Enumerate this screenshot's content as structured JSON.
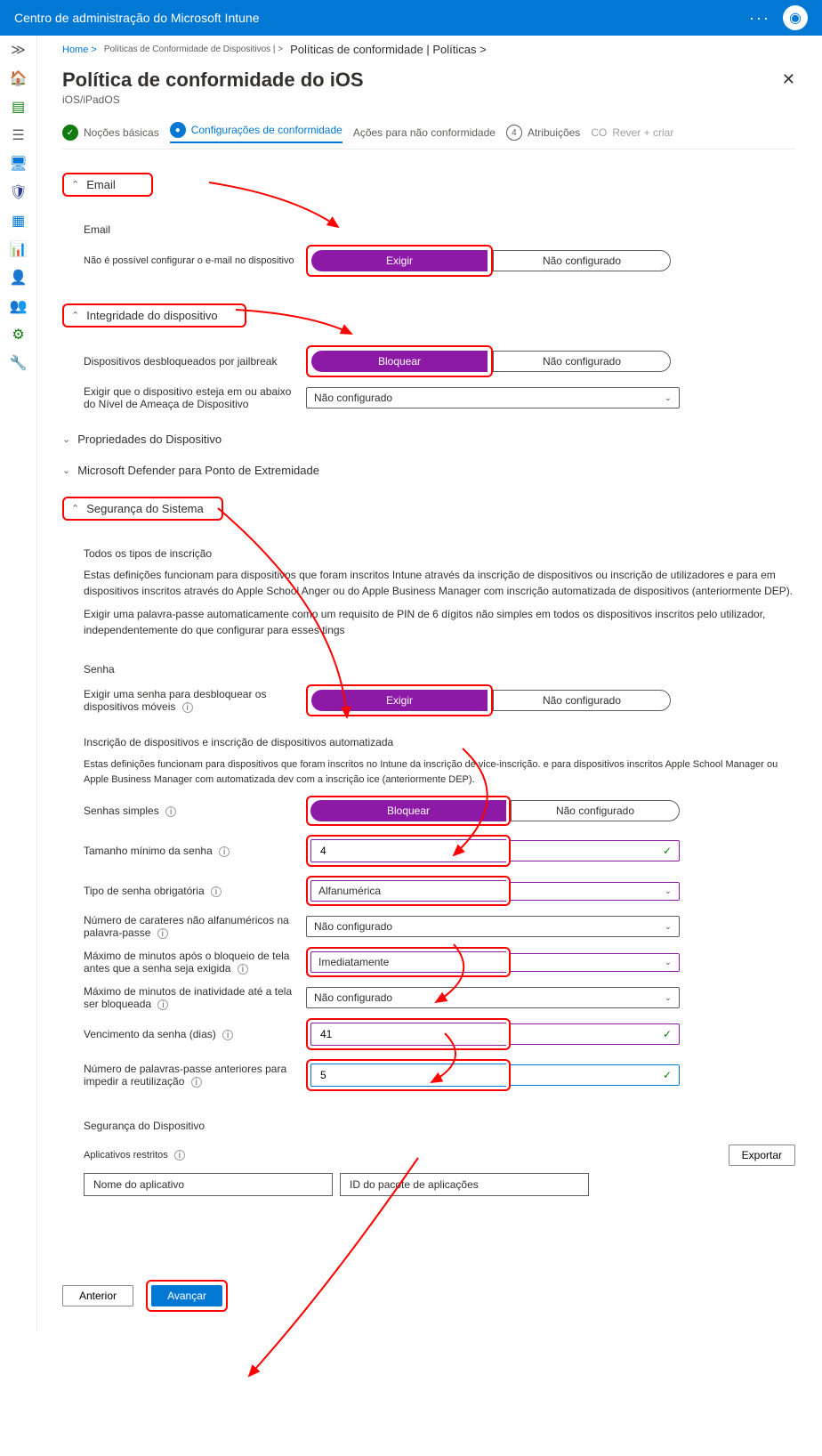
{
  "topbar": {
    "title": "Centro de administração do Microsoft Intune"
  },
  "breadcrumb": {
    "home": "Home >",
    "policies": "Políticas de Conformidade de Dispositivos | >",
    "current": "Políticas de conformidade | Políticas >"
  },
  "page": {
    "title": "Política de conformidade do iOS",
    "subtitle": "iOS/iPadOS"
  },
  "steps": {
    "s1": "Noções básicas",
    "s2": "Configurações de conformidade",
    "s3": "Ações para não conformidade",
    "s4num": "4",
    "s4": "Atribuições",
    "s5prefix": "CO",
    "s5": "Rever + criar"
  },
  "sections": {
    "email": "Email",
    "device_health": "Integridade do dispositivo",
    "device_props": "Propriedades do Dispositivo",
    "defender": "Microsoft Defender para Ponto de Extremidade",
    "system_security": "Segurança do Sistema"
  },
  "email": {
    "heading": "Email",
    "label": "Não é possível configurar o e-mail no dispositivo",
    "require": "Exigir",
    "not_configured": "Não configurado"
  },
  "device_health": {
    "jailbreak_label": "Dispositivos desbloqueados por jailbreak",
    "block": "Bloquear",
    "not_configured": "Não configurado",
    "threat_label": "Exigir que o dispositivo esteja em ou abaixo do Nível de Ameaça de Dispositivo",
    "threat_value": "Não configurado"
  },
  "system_security": {
    "all_enroll": "Todos os tipos de inscrição",
    "desc1": "Estas definições funcionam para dispositivos que foram inscritos   Intune através da inscrição de dispositivos ou inscrição de utilizadores e para em dispositivos inscritos através do Apple School Anger ou do Apple Business Manager com inscrição automatizada de dispositivos (anteriormente DEP).",
    "desc2": "Exigir uma palavra-passe automaticamente como um requisito de PIN de 6 dígitos não simples em todos os dispositivos inscritos pelo utilizador, independentemente do que configurar para esses tings",
    "password_heading": "Senha",
    "require_pwd_label": "Exigir uma senha para desbloquear os dispositivos móveis",
    "require": "Exigir",
    "not_configured": "Não configurado",
    "auto_enroll_heading": "Inscrição de dispositivos e inscrição de dispositivos automatizada",
    "auto_enroll_desc": "Estas definições funcionam para dispositivos que foram inscritos no    Intune           da inscrição de vice-inscrição. e para dispositivos inscritos Apple School Manager ou Apple Business Manager com automatizada      dev com a inscrição ice (anteriormente DEP).",
    "simple_pwd": "Senhas simples",
    "block": "Bloquear",
    "min_len": "Tamanho mínimo da senha",
    "min_len_value": "4",
    "pwd_type": "Tipo de senha obrigatória",
    "pwd_type_value": "Alfanumérica",
    "nonalpha": "Número de carateres não alfanuméricos na palavra-passe",
    "nonalpha_value": "Não configurado",
    "max_lock": "Máximo de minutos após o bloqueio de tela antes que a senha seja exigida",
    "max_lock_value": "Imediatamente",
    "max_inactive": "Máximo de minutos de inatividade até a tela ser bloqueada",
    "max_inactive_value": "Não configurado",
    "expiry": "Vencimento da senha (dias)",
    "expiry_value": "41",
    "prev_pwd": "Número de palavras-passe anteriores para impedir a reutilização",
    "prev_pwd_value": "5",
    "device_security": "Segurança do Dispositivo",
    "restricted_apps": "Aplicativos restritos",
    "export": "Exportar",
    "app_name": "Nome do aplicativo",
    "bundle_id": "ID do pacote de aplicações"
  },
  "footer": {
    "previous": "Anterior",
    "next": "Avançar"
  }
}
